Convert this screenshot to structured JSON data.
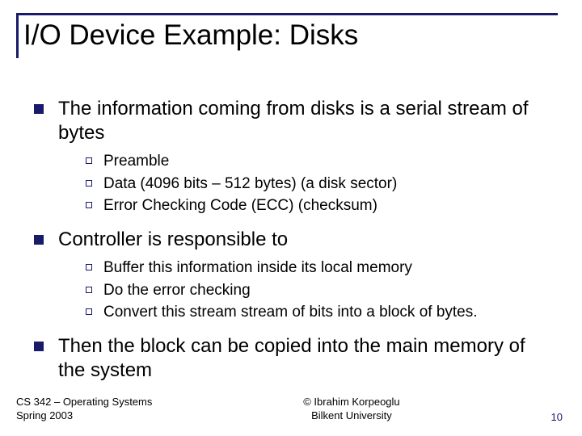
{
  "title": "I/O Device Example: Disks",
  "bullets": {
    "b1": "The information coming from disks is a serial stream of bytes",
    "b1s": {
      "a": "Preamble",
      "b": "Data (4096 bits – 512 bytes) (a disk sector)",
      "c": "Error Checking Code (ECC) (checksum)"
    },
    "b2": "Controller is responsible to",
    "b2s": {
      "a": "Buffer this information inside its local memory",
      "b": "Do the error checking",
      "c": "Convert this stream stream  of bits into a block of bytes."
    },
    "b3": "Then the block can be copied into the main memory of the system"
  },
  "footer": {
    "course": "CS 342 – Operating Systems",
    "term": "Spring 2003",
    "copyright": "© Ibrahim Korpeoglu",
    "university": "Bilkent University",
    "pagenum": "10"
  }
}
